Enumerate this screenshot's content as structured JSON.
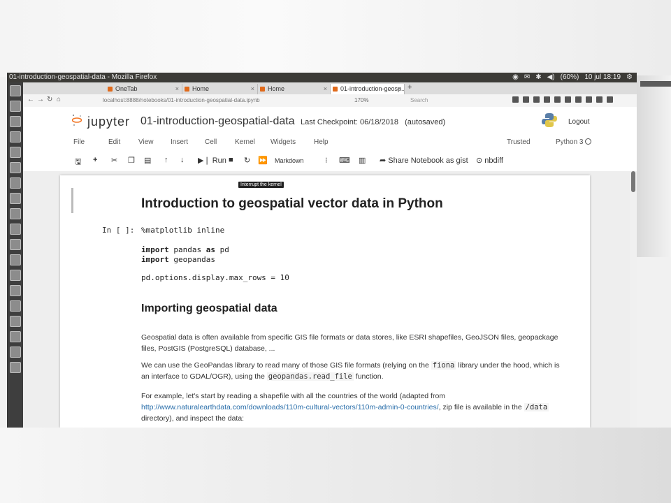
{
  "window": {
    "title": "01-introduction-geospatial-data - Mozilla Firefox"
  },
  "system_tray": {
    "battery": "(60%)",
    "clock": "10 jul 18:19"
  },
  "tabs": [
    {
      "label": "OneTab"
    },
    {
      "label": "Home"
    },
    {
      "label": "Home"
    },
    {
      "label": "01-introduction-geosp..."
    }
  ],
  "navbar": {
    "url": "localhost:8888/notebooks/01-introduction-geospatial-data.ipynb",
    "zoom": "170%",
    "search_placeholder": "Search"
  },
  "jupyter": {
    "logo": "jupyter",
    "notebook_name": "01-introduction-geospatial-data",
    "checkpoint": "Last Checkpoint: 06/18/2018",
    "autosaved": "(autosaved)",
    "logout": "Logout",
    "trusted": "Trusted",
    "kernel": "Python 3"
  },
  "menu": [
    "File",
    "Edit",
    "View",
    "Insert",
    "Cell",
    "Kernel",
    "Widgets",
    "Help"
  ],
  "toolbar": {
    "run_label": "Run",
    "cell_type": "Markdown",
    "share_label": "Share Notebook as gist",
    "nbdiff_label": "nbdiff",
    "tooltip": "Interrupt the kernel"
  },
  "notebook": {
    "h1": "Introduction to geospatial vector data in Python",
    "prompt": "In [ ]:",
    "code": {
      "line1": "%matplotlib inline",
      "line2_kw": "import",
      "line2_rest": " pandas ",
      "line2_as": "as",
      "line2_alias": " pd",
      "line3_kw": "import",
      "line3_rest": " geopandas",
      "line4": "pd.options.display.max_rows = 10"
    },
    "h2": "Importing geospatial data",
    "para1": "Geospatial data is often available from specific GIS file formats or data stores, like ESRI shapefiles, GeoJSON files, geopackage files, PostGIS (PostgreSQL) database, ...",
    "para2_a": "We can use the GeoPandas library to read many of those GIS file formats (relying on the ",
    "para2_code1": "fiona",
    "para2_b": " library under the hood, which is an interface to GDAL/OGR), using the ",
    "para2_code2": "geopandas.read_file",
    "para2_c": " function.",
    "para3_a": "For example, let's start by reading a shapefile with all the countries of the world (adapted from ",
    "para3_link": "http://www.naturalearthdata.com/downloads/110m-cultural-vectors/110m-admin-0-countries/",
    "para3_b": ", zip file is available in the ",
    "para3_code": "/data",
    "para3_c": " directory), and inspect the data:"
  }
}
